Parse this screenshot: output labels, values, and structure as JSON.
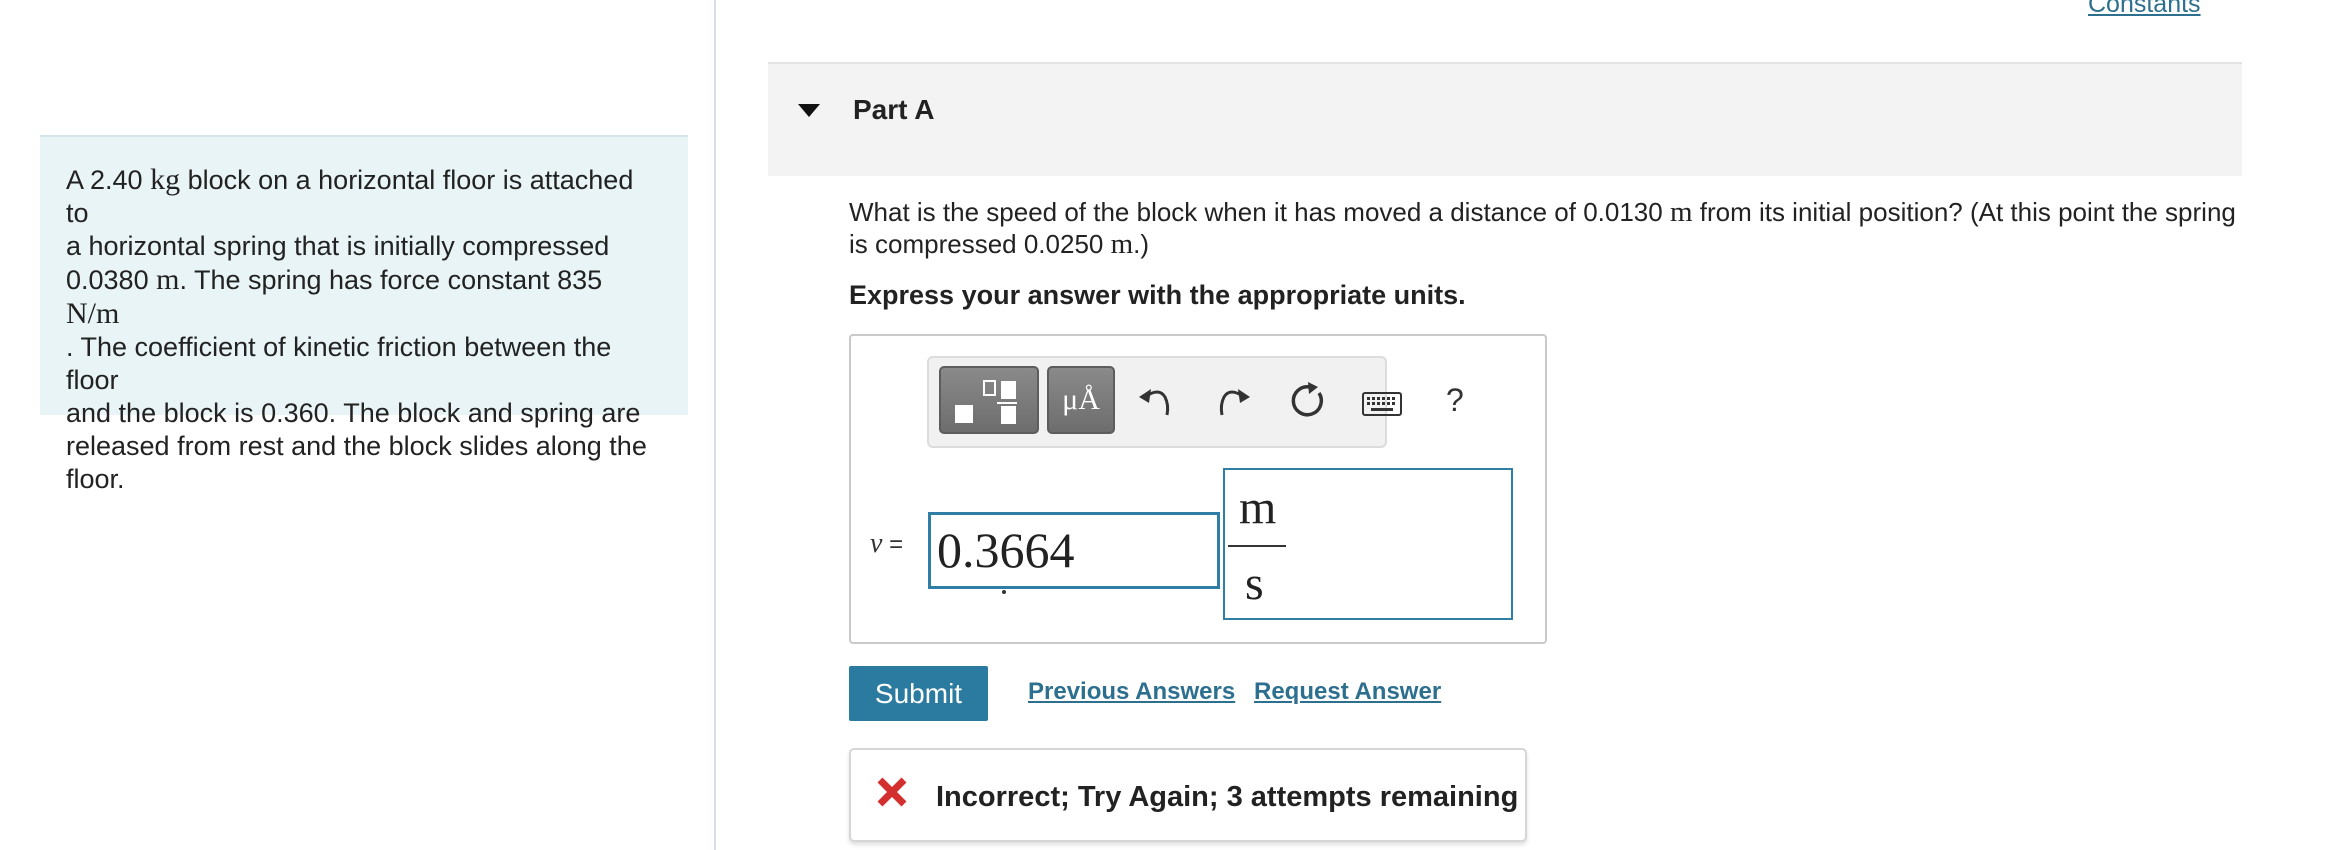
{
  "header": {
    "constants_link": "Constants"
  },
  "problem": {
    "lines": [
      [
        "A 2.40 ",
        "kg",
        " block on a horizontal floor is attached to"
      ],
      [
        "a horizontal spring that is initially compressed"
      ],
      [
        "0.0380 ",
        "m",
        ". The spring has force constant 835 ",
        "N/m"
      ],
      [
        ". The coefficient of kinetic friction between the floor"
      ],
      [
        "and the block is 0.360. The block and spring are"
      ],
      [
        "released from rest and the block slides along the"
      ],
      [
        "floor."
      ]
    ]
  },
  "part": {
    "title": "Part A",
    "question_line1_a": "What is the speed of the block when it has moved a distance of 0.0130 ",
    "question_line1_unit": "m",
    "question_line1_b": " from its initial position? (At this point the spring",
    "question_line2_a": "is compressed 0.0250 ",
    "question_line2_unit": "m",
    "question_line2_b": ".)",
    "instruction": "Express your answer with the appropriate units."
  },
  "toolbar": {
    "units_button": "μÅ",
    "help": "?",
    "icons": [
      "templates-icon",
      "units-icon",
      "undo-icon",
      "redo-icon",
      "reset-icon",
      "keyboard-icon",
      "help-icon"
    ]
  },
  "answer": {
    "variable": "v",
    "equals": " =",
    "value": "0.3664",
    "unit_numerator": "m",
    "unit_denominator": "s"
  },
  "actions": {
    "submit": "Submit",
    "previous_answers": "Previous Answers",
    "request_answer": "Request Answer"
  },
  "feedback": {
    "message": "Incorrect; Try Again; 3 attempts remaining",
    "color": "#d32f2f"
  },
  "colors": {
    "accent": "#2b7aa0",
    "link": "#2d6f8f",
    "panel": "#e9f4f6"
  }
}
